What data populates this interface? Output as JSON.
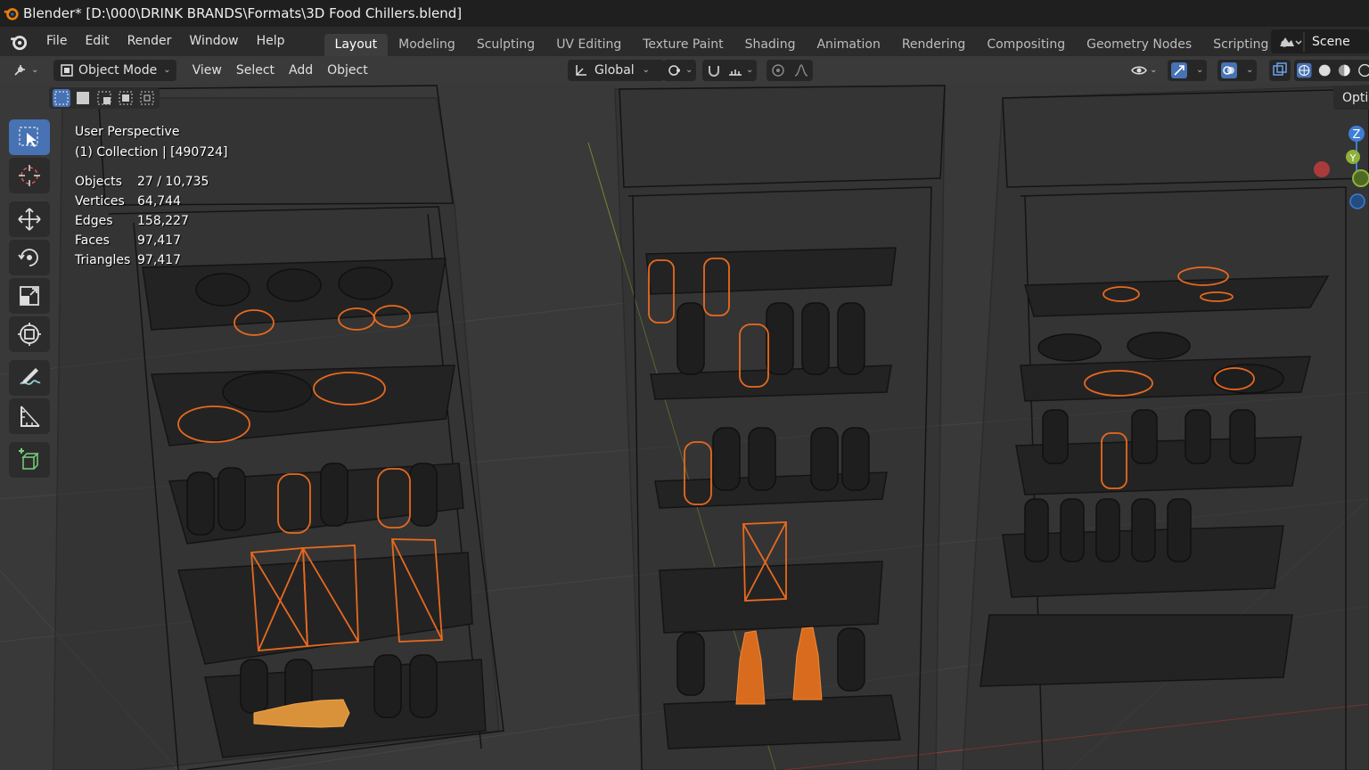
{
  "window": {
    "title": "Blender* [D:\\000\\DRINK BRANDS\\Formats\\3D Food Chillers.blend]"
  },
  "menu": [
    "File",
    "Edit",
    "Render",
    "Window",
    "Help"
  ],
  "workspaces": [
    "Layout",
    "Modeling",
    "Sculpting",
    "UV Editing",
    "Texture Paint",
    "Shading",
    "Animation",
    "Rendering",
    "Compositing",
    "Geometry Nodes",
    "Scripting"
  ],
  "active_workspace": "Layout",
  "scene_label": "Scene",
  "viewport_header": {
    "mode": "Object Mode",
    "menus": [
      "View",
      "Select",
      "Add",
      "Object"
    ],
    "transform_orientation": "Global",
    "options_label": "Optio"
  },
  "overlay": {
    "view_name": "User Perspective",
    "collection": "(1) Collection |  [490724]",
    "stats": [
      {
        "label": "Objects",
        "value": "27 / 10,735"
      },
      {
        "label": "Vertices",
        "value": "64,744"
      },
      {
        "label": "Edges",
        "value": "158,227"
      },
      {
        "label": "Faces",
        "value": "97,417"
      },
      {
        "label": "Triangles",
        "value": "97,417"
      }
    ]
  },
  "gizmo_axes": [
    "Z",
    "Y"
  ],
  "tools": [
    "select-box-tool",
    "cursor-tool",
    "move-tool",
    "rotate-tool",
    "scale-tool",
    "transform-tool",
    "annotate-tool",
    "measure-tool",
    "add-cube-tool"
  ],
  "colors": {
    "accent": "#4772b3",
    "selected": "#e8691f",
    "wire": "#1a1a1a",
    "axis_x": "#c93d3d",
    "axis_y": "#8fb03a",
    "axis_z": "#3e7ed6"
  }
}
